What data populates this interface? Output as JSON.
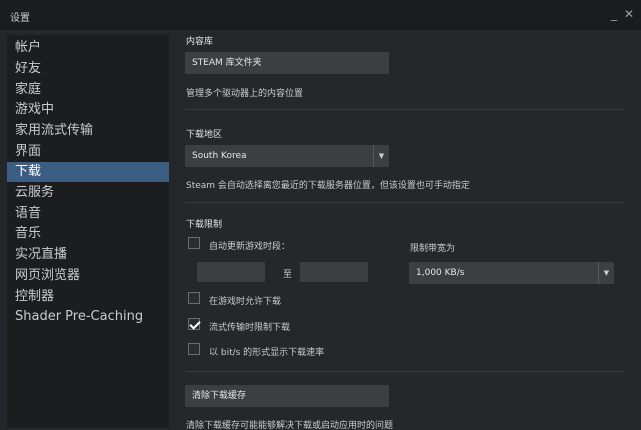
{
  "window": {
    "title": "设置",
    "minimize": "_",
    "close": "✕"
  },
  "sidebar": {
    "items": [
      {
        "label": "帐户"
      },
      {
        "label": "好友"
      },
      {
        "label": "家庭"
      },
      {
        "label": "游戏中"
      },
      {
        "label": "家用流式传输"
      },
      {
        "label": "界面"
      },
      {
        "label": "下载",
        "active": true
      },
      {
        "label": "云服务"
      },
      {
        "label": "语音"
      },
      {
        "label": "音乐"
      },
      {
        "label": "实况直播"
      },
      {
        "label": "网页浏览器"
      },
      {
        "label": "控制器"
      },
      {
        "label": "Shader Pre-Caching"
      }
    ]
  },
  "content_library": {
    "heading": "内容库",
    "button": "STEAM 库文件夹",
    "description": "管理多个驱动器上的内容位置"
  },
  "download_region": {
    "heading": "下载地区",
    "selected": "South Korea",
    "description": "Steam 会自动选择离您最近的下载服务器位置，但该设置也可手动指定"
  },
  "download_limits": {
    "heading": "下载限制",
    "auto_update_label": "自动更新游戏时段：",
    "to_label": "至",
    "bandwidth_label": "限制带宽为",
    "bandwidth_value": "1,000 KB/s",
    "allow_ingame_label": "在游戏时允许下载",
    "throttle_stream_label": "流式传输时限制下载",
    "show_bits_label": "以 bit/s 的形式显示下载速率",
    "auto_update_checked": false,
    "allow_ingame_checked": false,
    "throttle_stream_checked": true,
    "show_bits_checked": false
  },
  "cache": {
    "button": "清除下载缓存",
    "description": "清除下载缓存可能能够解决下载或启动应用时的问题"
  }
}
